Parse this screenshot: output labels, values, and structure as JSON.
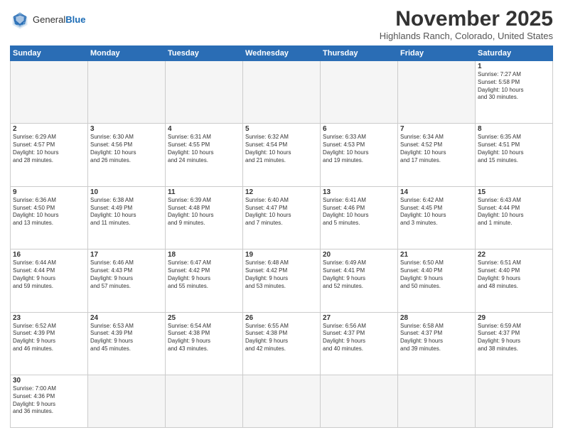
{
  "logo": {
    "text_general": "General",
    "text_blue": "Blue"
  },
  "title": "November 2025",
  "subtitle": "Highlands Ranch, Colorado, United States",
  "days_of_week": [
    "Sunday",
    "Monday",
    "Tuesday",
    "Wednesday",
    "Thursday",
    "Friday",
    "Saturday"
  ],
  "weeks": [
    [
      {
        "day": "",
        "info": ""
      },
      {
        "day": "",
        "info": ""
      },
      {
        "day": "",
        "info": ""
      },
      {
        "day": "",
        "info": ""
      },
      {
        "day": "",
        "info": ""
      },
      {
        "day": "",
        "info": ""
      },
      {
        "day": "1",
        "info": "Sunrise: 7:27 AM\nSunset: 5:58 PM\nDaylight: 10 hours\nand 30 minutes."
      }
    ],
    [
      {
        "day": "2",
        "info": "Sunrise: 6:29 AM\nSunset: 4:57 PM\nDaylight: 10 hours\nand 28 minutes."
      },
      {
        "day": "3",
        "info": "Sunrise: 6:30 AM\nSunset: 4:56 PM\nDaylight: 10 hours\nand 26 minutes."
      },
      {
        "day": "4",
        "info": "Sunrise: 6:31 AM\nSunset: 4:55 PM\nDaylight: 10 hours\nand 24 minutes."
      },
      {
        "day": "5",
        "info": "Sunrise: 6:32 AM\nSunset: 4:54 PM\nDaylight: 10 hours\nand 21 minutes."
      },
      {
        "day": "6",
        "info": "Sunrise: 6:33 AM\nSunset: 4:53 PM\nDaylight: 10 hours\nand 19 minutes."
      },
      {
        "day": "7",
        "info": "Sunrise: 6:34 AM\nSunset: 4:52 PM\nDaylight: 10 hours\nand 17 minutes."
      },
      {
        "day": "8",
        "info": "Sunrise: 6:35 AM\nSunset: 4:51 PM\nDaylight: 10 hours\nand 15 minutes."
      }
    ],
    [
      {
        "day": "9",
        "info": "Sunrise: 6:36 AM\nSunset: 4:50 PM\nDaylight: 10 hours\nand 13 minutes."
      },
      {
        "day": "10",
        "info": "Sunrise: 6:38 AM\nSunset: 4:49 PM\nDaylight: 10 hours\nand 11 minutes."
      },
      {
        "day": "11",
        "info": "Sunrise: 6:39 AM\nSunset: 4:48 PM\nDaylight: 10 hours\nand 9 minutes."
      },
      {
        "day": "12",
        "info": "Sunrise: 6:40 AM\nSunset: 4:47 PM\nDaylight: 10 hours\nand 7 minutes."
      },
      {
        "day": "13",
        "info": "Sunrise: 6:41 AM\nSunset: 4:46 PM\nDaylight: 10 hours\nand 5 minutes."
      },
      {
        "day": "14",
        "info": "Sunrise: 6:42 AM\nSunset: 4:45 PM\nDaylight: 10 hours\nand 3 minutes."
      },
      {
        "day": "15",
        "info": "Sunrise: 6:43 AM\nSunset: 4:44 PM\nDaylight: 10 hours\nand 1 minute."
      }
    ],
    [
      {
        "day": "16",
        "info": "Sunrise: 6:44 AM\nSunset: 4:44 PM\nDaylight: 9 hours\nand 59 minutes."
      },
      {
        "day": "17",
        "info": "Sunrise: 6:46 AM\nSunset: 4:43 PM\nDaylight: 9 hours\nand 57 minutes."
      },
      {
        "day": "18",
        "info": "Sunrise: 6:47 AM\nSunset: 4:42 PM\nDaylight: 9 hours\nand 55 minutes."
      },
      {
        "day": "19",
        "info": "Sunrise: 6:48 AM\nSunset: 4:42 PM\nDaylight: 9 hours\nand 53 minutes."
      },
      {
        "day": "20",
        "info": "Sunrise: 6:49 AM\nSunset: 4:41 PM\nDaylight: 9 hours\nand 52 minutes."
      },
      {
        "day": "21",
        "info": "Sunrise: 6:50 AM\nSunset: 4:40 PM\nDaylight: 9 hours\nand 50 minutes."
      },
      {
        "day": "22",
        "info": "Sunrise: 6:51 AM\nSunset: 4:40 PM\nDaylight: 9 hours\nand 48 minutes."
      }
    ],
    [
      {
        "day": "23",
        "info": "Sunrise: 6:52 AM\nSunset: 4:39 PM\nDaylight: 9 hours\nand 46 minutes."
      },
      {
        "day": "24",
        "info": "Sunrise: 6:53 AM\nSunset: 4:39 PM\nDaylight: 9 hours\nand 45 minutes."
      },
      {
        "day": "25",
        "info": "Sunrise: 6:54 AM\nSunset: 4:38 PM\nDaylight: 9 hours\nand 43 minutes."
      },
      {
        "day": "26",
        "info": "Sunrise: 6:55 AM\nSunset: 4:38 PM\nDaylight: 9 hours\nand 42 minutes."
      },
      {
        "day": "27",
        "info": "Sunrise: 6:56 AM\nSunset: 4:37 PM\nDaylight: 9 hours\nand 40 minutes."
      },
      {
        "day": "28",
        "info": "Sunrise: 6:58 AM\nSunset: 4:37 PM\nDaylight: 9 hours\nand 39 minutes."
      },
      {
        "day": "29",
        "info": "Sunrise: 6:59 AM\nSunset: 4:37 PM\nDaylight: 9 hours\nand 38 minutes."
      }
    ],
    [
      {
        "day": "30",
        "info": "Sunrise: 7:00 AM\nSunset: 4:36 PM\nDaylight: 9 hours\nand 36 minutes."
      },
      {
        "day": "",
        "info": ""
      },
      {
        "day": "",
        "info": ""
      },
      {
        "day": "",
        "info": ""
      },
      {
        "day": "",
        "info": ""
      },
      {
        "day": "",
        "info": ""
      },
      {
        "day": "",
        "info": ""
      }
    ]
  ]
}
